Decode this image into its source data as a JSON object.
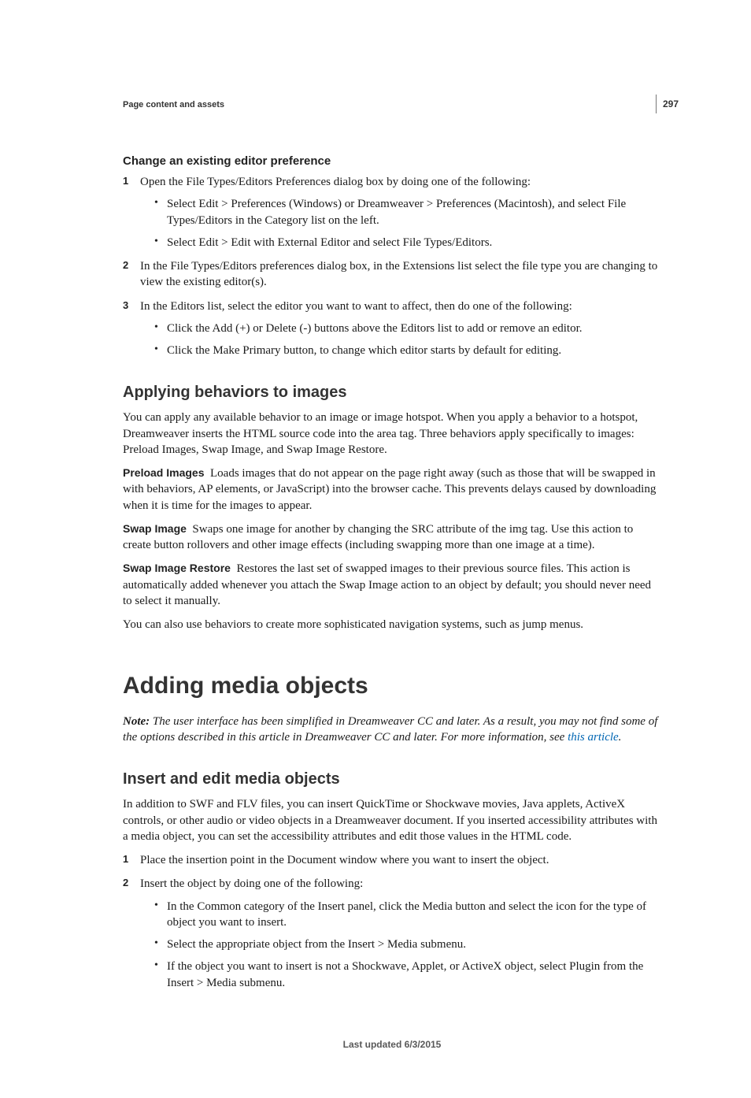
{
  "page_number": "297",
  "running_head": "Page content and assets",
  "section1": {
    "heading": "Change an existing editor preference",
    "steps": [
      {
        "num": "1",
        "text": "Open the File Types/Editors Preferences dialog box by doing one of the following:",
        "bullets": [
          "Select Edit > Preferences (Windows) or Dreamweaver > Preferences (Macintosh), and select File Types/Editors in the Category list on the left.",
          "Select Edit > Edit with External Editor and select File Types/Editors."
        ]
      },
      {
        "num": "2",
        "text": "In the File Types/Editors preferences dialog box, in the Extensions list select the file type you are changing to view the existing editor(s)."
      },
      {
        "num": "3",
        "text": "In the Editors list, select the editor you want to want to affect, then do one of the following:",
        "bullets": [
          "Click the Add (+) or Delete (-) buttons above the Editors list to add or remove an editor.",
          "Click the Make Primary button, to change which editor starts by default for editing."
        ]
      }
    ]
  },
  "section2": {
    "heading": "Applying behaviors to images",
    "intro": "You can apply any available behavior to an image or image hotspot. When you apply a behavior to a hotspot, Dreamweaver inserts the HTML source code into the area tag. Three behaviors apply specifically to images: Preload Images, Swap Image, and Swap Image Restore.",
    "defs": [
      {
        "term": "Preload Images",
        "body": "Loads images that do not appear on the page right away (such as those that will be swapped in with behaviors, AP elements, or JavaScript) into the browser cache. This prevents delays caused by downloading when it is time for the images to appear."
      },
      {
        "term": "Swap Image",
        "body": "Swaps one image for another by changing the SRC attribute of the img tag. Use this action to create button rollovers and other image effects (including swapping more than one image at a time)."
      },
      {
        "term": "Swap Image Restore",
        "body": "Restores the last set of swapped images to their previous source files. This action is automatically added whenever you attach the Swap Image action to an object by default; you should never need to select it manually."
      }
    ],
    "outro": "You can also use behaviors to create more sophisticated navigation systems, such as jump menus."
  },
  "section3": {
    "heading": "Adding media objects",
    "note_lead": "Note: ",
    "note_body1": "The user interface has been simplified in Dreamweaver CC and later. As a result, you may not find some of the options described in this article in Dreamweaver CC and later. For more information, see ",
    "note_link": "this article",
    "note_body2": ".",
    "sub_heading": "Insert and edit media objects",
    "sub_intro": "In addition to SWF and FLV files, you can insert QuickTime or Shockwave movies, Java applets, ActiveX controls, or other audio or video objects in a Dreamweaver document. If you inserted accessibility attributes with a media object, you can set the accessibility attributes and edit those values in the HTML code.",
    "steps": [
      {
        "num": "1",
        "text": "Place the insertion point in the Document window where you want to insert the object."
      },
      {
        "num": "2",
        "text": "Insert the object by doing one of the following:",
        "bullets": [
          "In the Common category of the Insert panel, click the Media button and select the icon for the type of object you want to insert.",
          "Select the appropriate object from the Insert > Media submenu.",
          "If the object you want to insert is not a Shockwave, Applet, or ActiveX object, select Plugin from the Insert > Media submenu."
        ]
      }
    ]
  },
  "footer": "Last updated 6/3/2015"
}
